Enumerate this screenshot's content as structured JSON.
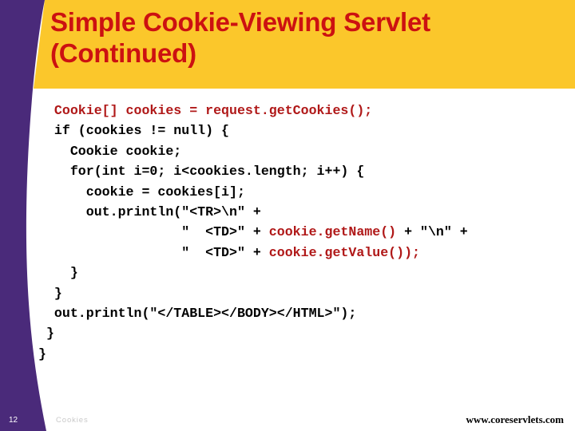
{
  "slide": {
    "title": "Simple Cookie-Viewing Servlet\n(Continued)",
    "title_color": "#CC1111",
    "banner_color": "#FBC72B",
    "band_color": "#4A2A7A",
    "code_highlight_color": "#B01818",
    "code_color": "#000000"
  },
  "code": {
    "lines": [
      {
        "segments": [
          {
            "text": "  Cookie[] cookies = request.getCookies();",
            "highlight": true
          }
        ]
      },
      {
        "segments": [
          {
            "text": "  if (cookies != null) {",
            "highlight": false
          }
        ]
      },
      {
        "segments": [
          {
            "text": "    Cookie cookie;",
            "highlight": false
          }
        ]
      },
      {
        "segments": [
          {
            "text": "    for(int i=0; i<cookies.length; i++) {",
            "highlight": false
          }
        ]
      },
      {
        "segments": [
          {
            "text": "      cookie = cookies[i];",
            "highlight": false
          }
        ]
      },
      {
        "segments": [
          {
            "text": "      out.println(\"<TR>\\n\" +",
            "highlight": false
          }
        ]
      },
      {
        "segments": [
          {
            "text": "                  \"  <TD>\" + ",
            "highlight": false
          },
          {
            "text": "cookie.getName()",
            "highlight": true
          },
          {
            "text": " + \"\\n\" +",
            "highlight": false
          }
        ]
      },
      {
        "segments": [
          {
            "text": "                  \"  <TD>\" + ",
            "highlight": false
          },
          {
            "text": "cookie.getValue());",
            "highlight": true
          }
        ]
      },
      {
        "segments": [
          {
            "text": "    }",
            "highlight": false
          }
        ]
      },
      {
        "segments": [
          {
            "text": "  }",
            "highlight": false
          }
        ]
      },
      {
        "segments": [
          {
            "text": "  out.println(\"</TABLE></BODY></HTML>\");",
            "highlight": false
          }
        ]
      },
      {
        "segments": [
          {
            "text": " }",
            "highlight": false
          }
        ]
      },
      {
        "segments": [
          {
            "text": "}",
            "highlight": false
          }
        ]
      }
    ]
  },
  "footer": {
    "page_number": "12",
    "section_label": "Cookies",
    "url": "www.coreservlets.com"
  }
}
